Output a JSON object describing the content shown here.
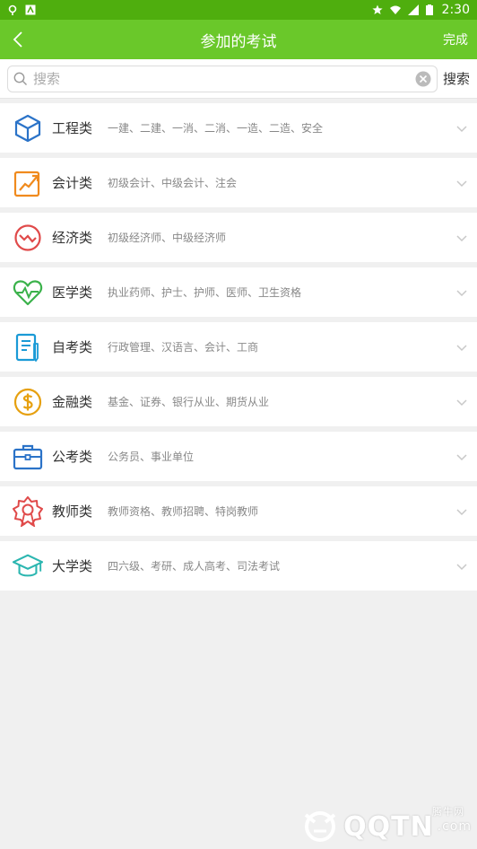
{
  "status_bar": {
    "time": "2:30"
  },
  "app_bar": {
    "title": "参加的考试",
    "done_label": "完成"
  },
  "search": {
    "placeholder": "搜索",
    "button_label": "搜索"
  },
  "categories": [
    {
      "name": "工程类",
      "desc": "一建、二建、一消、二消、一造、二造、安全",
      "icon": "cube-icon",
      "color": "#2b73c8"
    },
    {
      "name": "会计类",
      "desc": "初级会计、中级会计、注会",
      "icon": "growth-chart-icon",
      "color": "#f08a1d"
    },
    {
      "name": "经济类",
      "desc": "初级经济师、中级经济师",
      "icon": "trend-circle-icon",
      "color": "#e04a4a"
    },
    {
      "name": "医学类",
      "desc": "执业药师、护士、护师、医师、卫生资格",
      "icon": "heartbeat-icon",
      "color": "#3bb24b"
    },
    {
      "name": "自考类",
      "desc": "行政管理、汉语言、会计、工商",
      "icon": "notebook-icon",
      "color": "#1a9ad6"
    },
    {
      "name": "金融类",
      "desc": "基金、证券、银行从业、期货从业",
      "icon": "dollar-coin-icon",
      "color": "#e6a00f"
    },
    {
      "name": "公考类",
      "desc": "公务员、事业单位",
      "icon": "briefcase-icon",
      "color": "#2b73c8"
    },
    {
      "name": "教师类",
      "desc": "教师资格、教师招聘、特岗教师",
      "icon": "award-badge-icon",
      "color": "#e04a4a"
    },
    {
      "name": "大学类",
      "desc": "四六级、考研、成人高考、司法考试",
      "icon": "graduation-cap-icon",
      "color": "#2bb6b0"
    }
  ],
  "watermark": {
    "brand": "QQTN",
    "suffix": ".com",
    "site_cn": "腾牛网"
  }
}
